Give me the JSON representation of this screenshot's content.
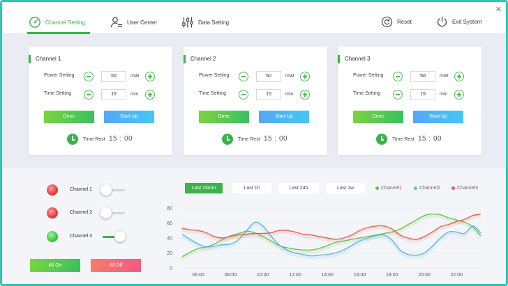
{
  "nav": {
    "items": [
      {
        "label": "Channel Setting",
        "icon": "gauge-icon",
        "active": true
      },
      {
        "label": "User Center",
        "icon": "user-list-icon",
        "active": false
      },
      {
        "label": "Data Setting",
        "icon": "sliders-icon",
        "active": false
      }
    ],
    "reset_label": "Reset",
    "exit_label": "Exit System",
    "close_glyph": "✕"
  },
  "channels": [
    {
      "title": "Channel 1",
      "power_label": "Power Setting",
      "power_value": "50",
      "power_unit": "mW",
      "time_label": "Time Setting",
      "time_value": "15",
      "time_unit": "min",
      "done_label": "Done",
      "start_label": "Start Up",
      "time_rest_label": "Time Rest",
      "time_rest_value": "15 : 00"
    },
    {
      "title": "Channel 2",
      "power_label": "Power Setting",
      "power_value": "50",
      "power_unit": "mW",
      "time_label": "Time Setting",
      "time_value": "15",
      "time_unit": "min",
      "done_label": "Done",
      "start_label": "Start Up",
      "time_rest_label": "Time Rest",
      "time_rest_value": "15 : 00"
    },
    {
      "title": "Channel 3",
      "power_label": "Power Setting",
      "power_value": "50",
      "power_unit": "mW",
      "time_label": "Time Setting",
      "time_value": "15",
      "time_unit": "min",
      "done_label": "Done",
      "start_label": "Start Up",
      "time_rest_label": "Time Rest",
      "time_rest_value": "15 : 00"
    }
  ],
  "toggles": [
    {
      "label": "Channel 1",
      "status": "red",
      "on": false
    },
    {
      "label": "Channel 2",
      "status": "red",
      "on": false
    },
    {
      "label": "Channel 3",
      "status": "green",
      "on": true
    }
  ],
  "all_on_label": "All On",
  "all_off_label": "All Off",
  "range_tabs": [
    {
      "label": "Last 15min",
      "active": true
    },
    {
      "label": "Last 1h",
      "active": false
    },
    {
      "label": "Last 24h",
      "active": false
    },
    {
      "label": "Last 1w",
      "active": false
    }
  ],
  "colors": {
    "accent": "#3cb24a",
    "frame": "#2ec7b4"
  },
  "chart_data": {
    "type": "line",
    "x": [
      "05:00",
      "05:30",
      "06:00",
      "06:30",
      "07:00",
      "07:30",
      "08:00",
      "08:30",
      "09:00",
      "09:30",
      "10:00",
      "10:30",
      "11:00",
      "11:30",
      "12:00",
      "12:30",
      "13:00",
      "13:30",
      "14:00",
      "14:30",
      "15:00",
      "15:30",
      "16:00",
      "16:30",
      "17:00",
      "17:30",
      "18:00",
      "18:30",
      "19:00",
      "19:30",
      "20:00",
      "20:30",
      "21:00",
      "21:30",
      "22:00",
      "22:30",
      "23:00",
      "23:30"
    ],
    "xticks": [
      "06:00",
      "08:00",
      "10:00",
      "12:00",
      "14:00",
      "16:00",
      "18:00",
      "20:00",
      "22:00"
    ],
    "yticks": [
      0,
      20,
      40,
      60,
      80
    ],
    "ylim": [
      0,
      80
    ],
    "grid": true,
    "legend_position": "top-right",
    "series": [
      {
        "name": "Channel1",
        "color": "#6cc04a",
        "values": [
          15,
          21,
          26,
          28,
          32,
          38,
          43,
          46,
          49,
          47,
          42,
          36,
          30,
          27,
          25,
          24,
          24,
          26,
          30,
          34,
          36,
          38,
          40,
          42,
          44,
          46,
          48,
          52,
          58,
          64,
          70,
          72,
          71,
          67,
          64,
          61,
          55,
          43
        ]
      },
      {
        "name": "Channel2",
        "color": "#5ab8e8",
        "values": [
          45,
          38,
          32,
          28,
          29,
          31,
          32,
          38,
          50,
          61,
          56,
          43,
          31,
          24,
          20,
          18,
          16,
          17,
          18,
          20,
          24,
          30,
          36,
          40,
          43,
          44,
          37,
          24,
          18,
          17,
          20,
          29,
          40,
          48,
          48,
          46,
          56,
          47
        ]
      },
      {
        "name": "Channel3",
        "color": "#ee5b4c",
        "values": [
          53,
          51,
          50,
          47,
          42,
          40,
          42,
          44,
          45,
          46,
          46,
          47,
          50,
          50,
          48,
          45,
          44,
          42,
          40,
          38,
          40,
          44,
          50,
          54,
          56,
          56,
          52,
          44,
          40,
          38,
          42,
          48,
          55,
          58,
          62,
          65,
          70,
          72
        ]
      }
    ]
  }
}
